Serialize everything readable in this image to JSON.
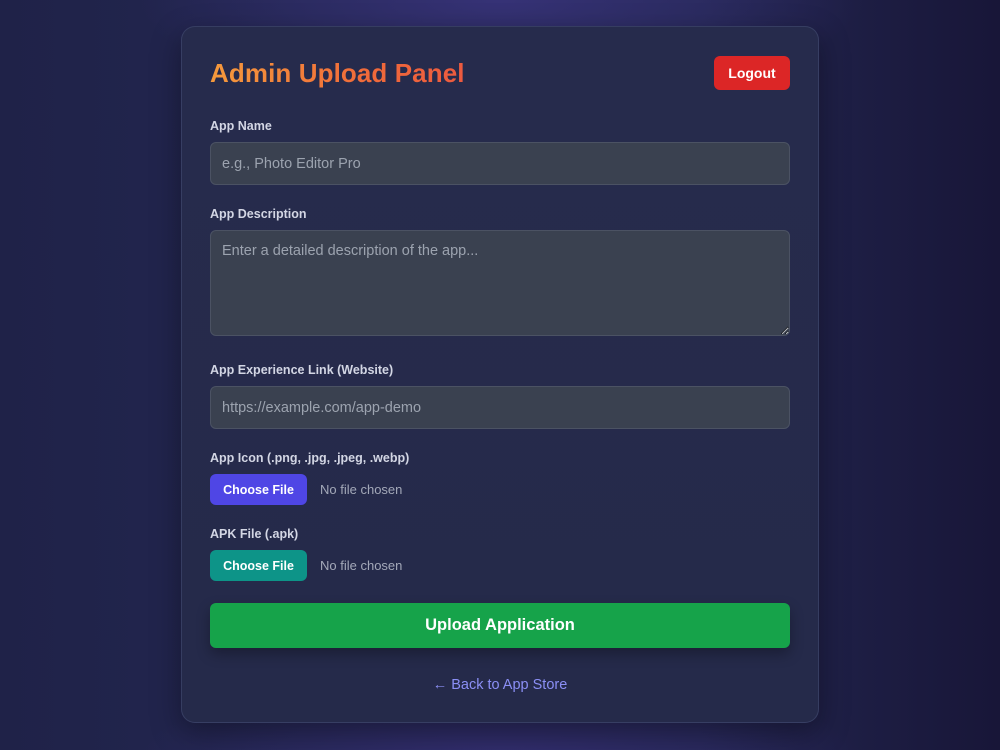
{
  "header": {
    "title": "Admin Upload Panel",
    "logout_label": "Logout"
  },
  "form": {
    "app_name": {
      "label": "App Name",
      "placeholder": "e.g., Photo Editor Pro",
      "value": ""
    },
    "app_description": {
      "label": "App Description",
      "placeholder": "Enter a detailed description of the app...",
      "value": ""
    },
    "experience_link": {
      "label": "App Experience Link (Website)",
      "placeholder": "https://example.com/app-demo",
      "value": ""
    },
    "app_icon": {
      "label": "App Icon (.png, .jpg, .jpeg, .webp)",
      "button_label": "Choose File",
      "status": "No file chosen"
    },
    "apk_file": {
      "label": "APK File (.apk)",
      "button_label": "Choose File",
      "status": "No file chosen"
    },
    "submit_label": "Upload Application"
  },
  "footer": {
    "back_link": "← Back to App Store"
  },
  "colors": {
    "logout": "#dc2626",
    "icon_button": "#4f46e5",
    "apk_button": "#0d9488",
    "submit": "#16a34a",
    "link": "#8b8ff5"
  }
}
